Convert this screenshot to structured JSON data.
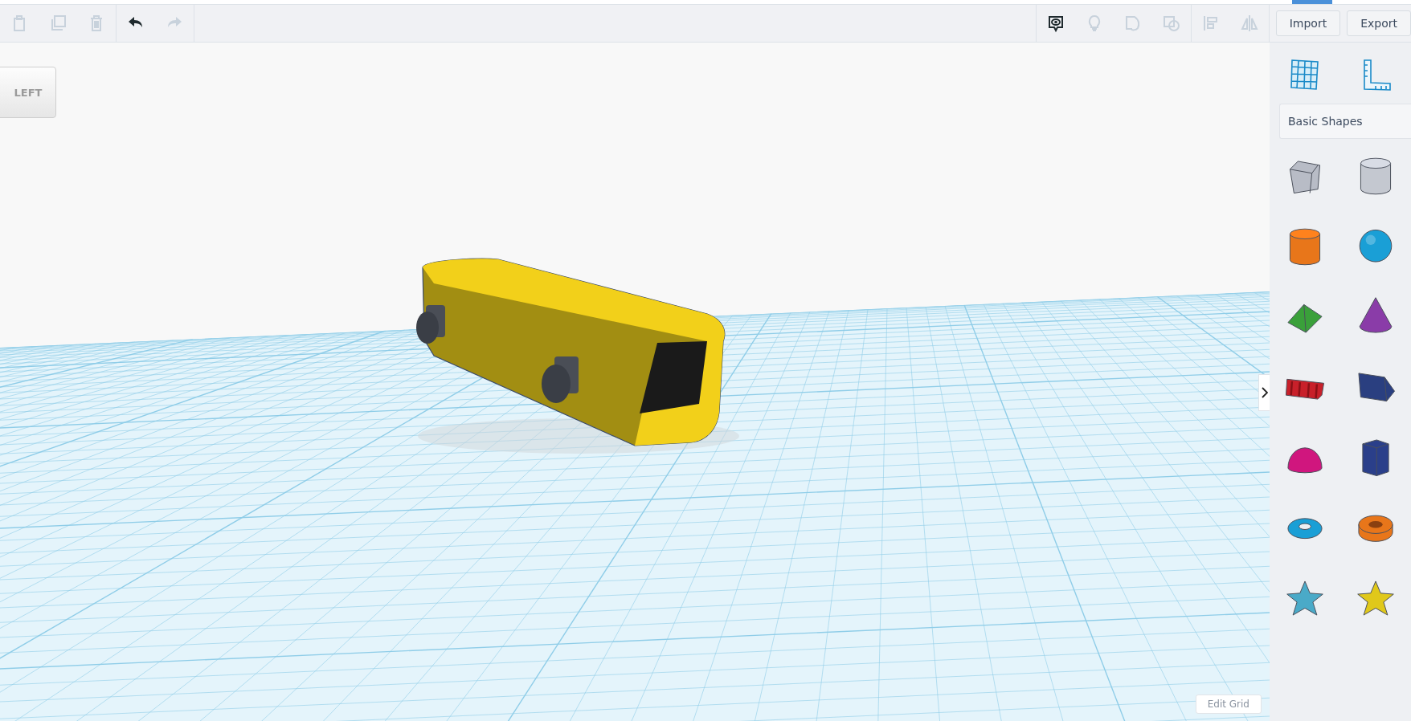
{
  "toolbar": {
    "left_tools": [
      {
        "kind": "paste",
        "disabled": true
      },
      {
        "kind": "duplicate",
        "disabled": true
      },
      {
        "kind": "delete",
        "disabled": true
      },
      {
        "kind": "divider"
      },
      {
        "kind": "undo",
        "disabled": false
      },
      {
        "kind": "redo",
        "disabled": true
      }
    ],
    "right_tools": [
      {
        "kind": "notes",
        "disabled": false
      },
      {
        "kind": "bulb",
        "disabled": true
      },
      {
        "kind": "group",
        "disabled": true
      },
      {
        "kind": "ungroup",
        "disabled": true
      },
      {
        "kind": "divider"
      },
      {
        "kind": "align",
        "disabled": true
      },
      {
        "kind": "mirror",
        "disabled": true
      }
    ],
    "buttons": [
      "Import",
      "Export"
    ]
  },
  "viewport": {
    "view_cube": {
      "label": "LEFT"
    },
    "edit_grid_button": "Edit Grid"
  },
  "sidebar": {
    "tools": [
      {
        "kind": "workplane"
      },
      {
        "kind": "ruler"
      }
    ],
    "category": {
      "value": "Basic Shapes"
    },
    "shapes": [
      {
        "kind": "box",
        "color": "#b8bcc6"
      },
      {
        "kind": "cylinder",
        "color": "#c4c8d0"
      },
      {
        "kind": "cylinder",
        "color": "#e8761a"
      },
      {
        "kind": "sphere",
        "color": "#1a9fd6"
      },
      {
        "kind": "roof",
        "color": "#3aa03a"
      },
      {
        "kind": "cone",
        "color": "#8a3ca8"
      },
      {
        "kind": "text",
        "color": "#c8202a"
      },
      {
        "kind": "wedge",
        "color": "#2a3f80"
      },
      {
        "kind": "half-sphere",
        "color": "#d0167e"
      },
      {
        "kind": "prism",
        "color": "#2a3f8a"
      },
      {
        "kind": "torus",
        "color": "#1a9fd6"
      },
      {
        "kind": "tube",
        "color": "#e8761a"
      },
      {
        "kind": "star",
        "color": "#4aaac8"
      },
      {
        "kind": "star",
        "color": "#e0c81a"
      }
    ]
  }
}
